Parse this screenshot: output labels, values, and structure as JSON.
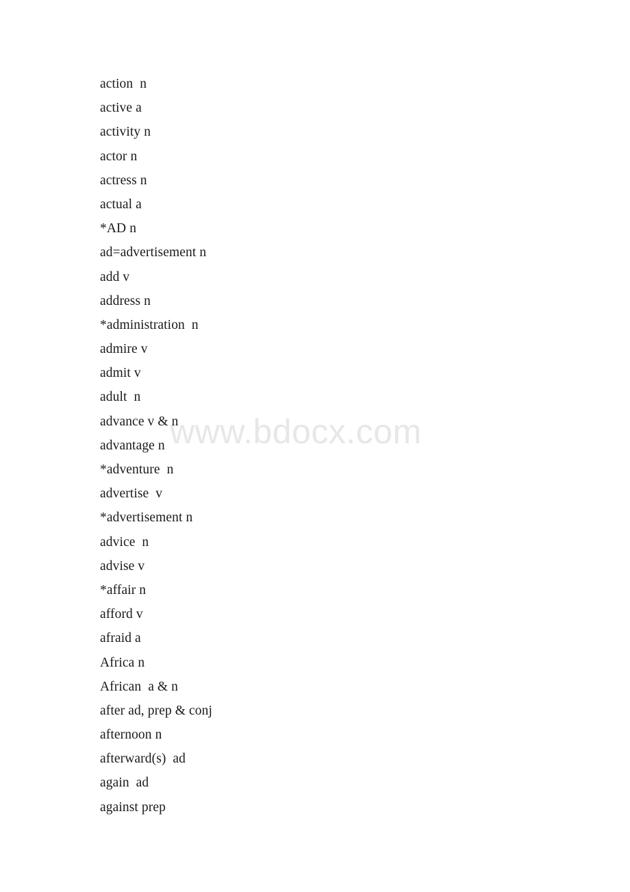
{
  "document": {
    "type": "word-list",
    "background_color": "#ffffff",
    "text_color": "#1a1a1a"
  },
  "watermark": {
    "text": "www.bdocx.com",
    "color": "#e7e7e7"
  },
  "word_list": {
    "entries": [
      {
        "term": "action  n"
      },
      {
        "term": "active a"
      },
      {
        "term": "activity n"
      },
      {
        "term": "actor n"
      },
      {
        "term": "actress n"
      },
      {
        "term": "actual a"
      },
      {
        "term": "*AD n"
      },
      {
        "term": "ad=advertisement n"
      },
      {
        "term": "add v"
      },
      {
        "term": "address n"
      },
      {
        "term": "*administration  n"
      },
      {
        "term": "admire v"
      },
      {
        "term": "admit v"
      },
      {
        "term": "adult  n"
      },
      {
        "term": "advance v & n"
      },
      {
        "term": "advantage n"
      },
      {
        "term": "*adventure  n"
      },
      {
        "term": "advertise  v"
      },
      {
        "term": "*advertisement n"
      },
      {
        "term": "advice  n"
      },
      {
        "term": "advise v"
      },
      {
        "term": "*affair n"
      },
      {
        "term": "afford v"
      },
      {
        "term": "afraid a"
      },
      {
        "term": "Africa n"
      },
      {
        "term": "African  a & n"
      },
      {
        "term": "after ad, prep & conj"
      },
      {
        "term": "afternoon n"
      },
      {
        "term": "afterward(s)  ad"
      },
      {
        "term": "again  ad"
      },
      {
        "term": "against prep"
      }
    ]
  }
}
